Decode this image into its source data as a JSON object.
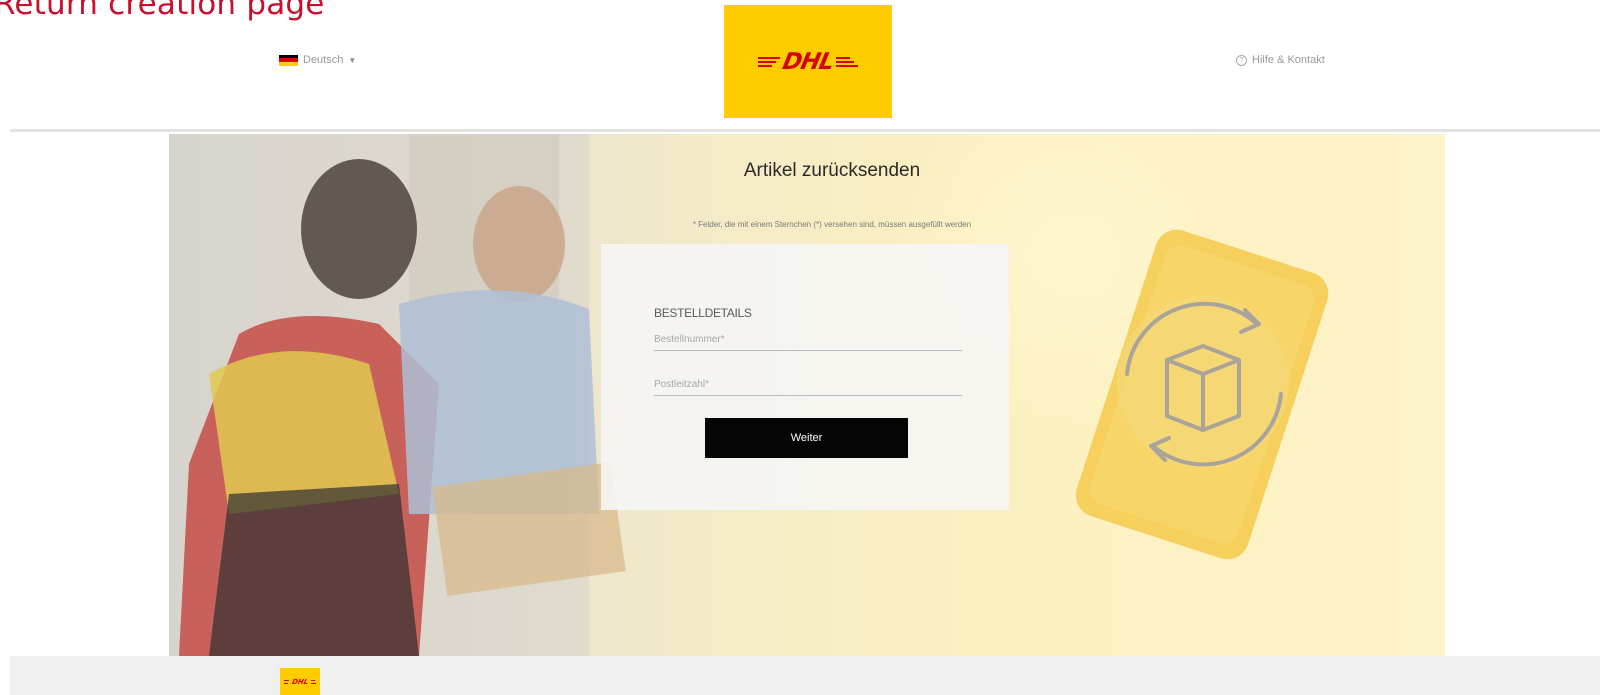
{
  "caption": "Return creation page",
  "header": {
    "language": {
      "label": "Deutsch",
      "flag_colors": [
        "#000000",
        "#dd0000",
        "#ffce00"
      ]
    },
    "logo_text": "DHL",
    "help_link": "Hilfe & Kontakt"
  },
  "hero": {
    "title": "Artikel zurücksenden",
    "required_note": "* Felder, die mit einem Sternchen (*) versehen sind, müssen ausgefüllt werden",
    "illustration_icon": "box-return-icon"
  },
  "form": {
    "section_title": "BESTELLDETAILS",
    "order_number_placeholder": "Bestellnummer*",
    "postal_code_placeholder": "Postleitzahl*",
    "submit_label": "Weiter"
  },
  "footer": {
    "logo_text": "DHL"
  },
  "colors": {
    "caption": "#c8102e",
    "dhl_yellow": "#ffcc00",
    "dhl_red": "#d40511",
    "button": "#050505"
  }
}
